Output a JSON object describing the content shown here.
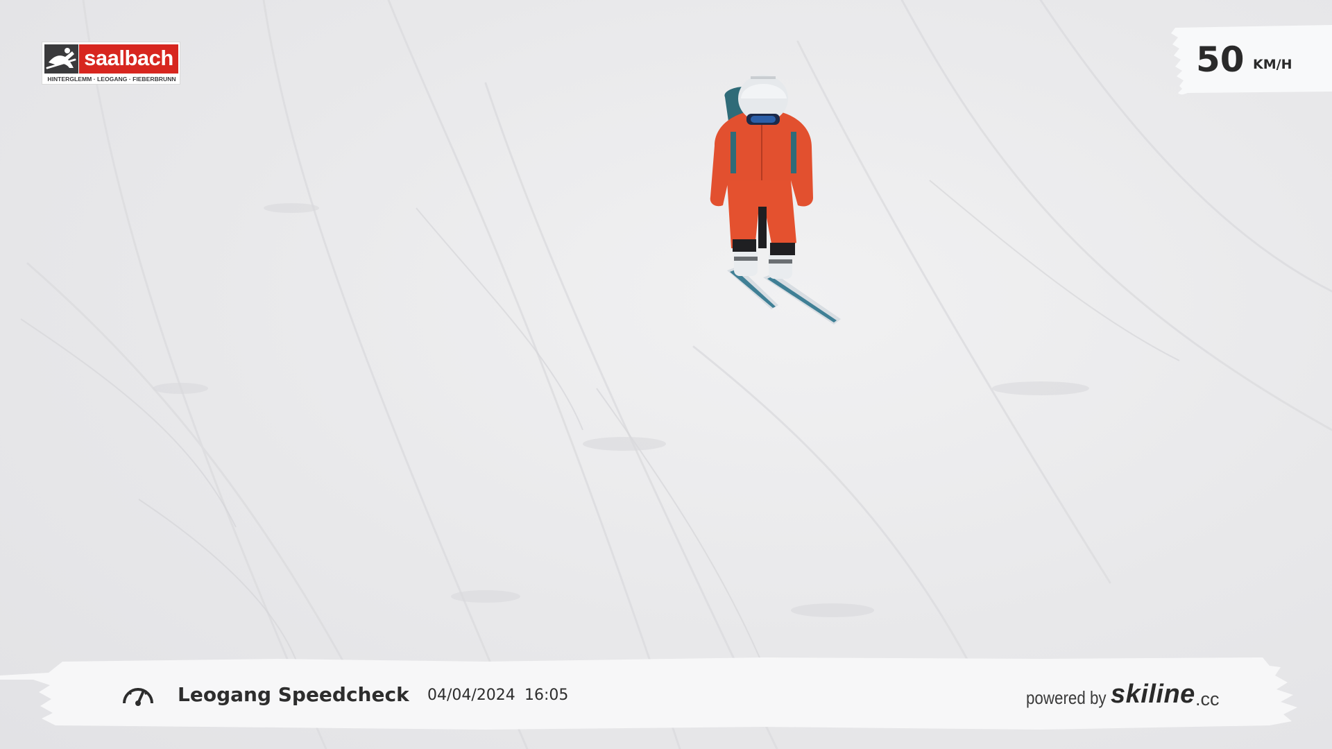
{
  "logo": {
    "name": "saalbach",
    "subline": "HINTERGLEMM · LEOGANG · FIEBERBRUNN",
    "emblem_icon": "leaping-skier-icon",
    "colors": {
      "red": "#d7261f",
      "dark": "#3a3a3c"
    }
  },
  "speed": {
    "value": "50",
    "unit": "KM/H"
  },
  "banner": {
    "icon": "speedometer-icon",
    "title": "Leogang Speedcheck",
    "date": "04/04/2024",
    "time": "16:05",
    "powered_by": "powered by",
    "provider_name": "skiline",
    "provider_tld": ".cc"
  },
  "scene": {
    "subject": "skier-icon",
    "colors": {
      "snow": "#e9e9ea",
      "jacket": "#e2502f",
      "helmet": "#e6e9ec"
    }
  }
}
